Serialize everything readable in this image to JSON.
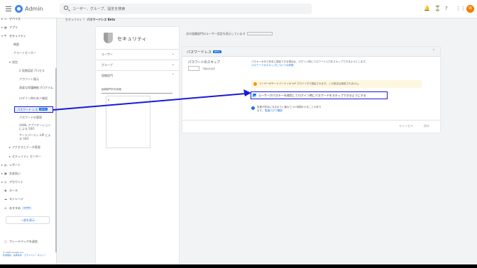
{
  "app": {
    "title": "Admin",
    "avatar_initial": "W"
  },
  "search": {
    "placeholder": "ユーザー、グループ、設定を検索"
  },
  "topbar": {
    "icons": [
      "notifications-icon",
      "hourglass-icon",
      "help-icon",
      "apps-icon"
    ]
  },
  "sidebar": {
    "items": [
      {
        "label": "デバイス"
      },
      {
        "label": "アプリ"
      },
      {
        "label": "セキュリティ"
      },
      {
        "label": "概要"
      },
      {
        "label": "アラートセンター"
      },
      {
        "label": "設定"
      },
      {
        "label": "2 段階認証プロセス"
      },
      {
        "label": "アカウント復元"
      },
      {
        "label": "高度な保護機能プログラム"
      },
      {
        "label": "ログイン時の本人確認"
      },
      {
        "label": "パスワード レス",
        "badge": "BETA"
      },
      {
        "label": "パスワードの管理"
      },
      {
        "label": "SAML アプリケーションによる SSO"
      },
      {
        "label": "サードパーティ IdP による SSO"
      },
      {
        "label": "アクセスとデータ管理"
      },
      {
        "label": "セキュリティ センター"
      },
      {
        "label": "レポート"
      },
      {
        "label": "お支払い"
      },
      {
        "label": "アカウント"
      },
      {
        "label": "ルール"
      },
      {
        "label": "ストレージ"
      },
      {
        "label": "おすすめ",
        "badge": "ALPHA"
      }
    ],
    "more_button": "一部を表示",
    "feedback": "フィードバックを送信",
    "footer_line1": "© 2025 Google Inc.",
    "footer_line2": "利用規約 · 請求条件 · プライバシー ポリシー"
  },
  "breadcrumb": {
    "parent": "セキュリティ",
    "sep": "〉",
    "current": "パスワードレス Beta"
  },
  "left_panel": {
    "title": "セキュリティ",
    "rows": [
      "ユーザー",
      "グループ",
      "組織部門"
    ],
    "search_label": "組織部門内を検索"
  },
  "top_info": "次の組織部門のユーザー設定を表示しています",
  "card": {
    "header": "パスワードレス",
    "header_badge": "BETA",
    "setting_label": "パスワードのスキップ",
    "setting_sub": "下線付き表示",
    "description": "パスキーのみで安全に認証できる場合は、ログイン時にパスワード入力をスキップできるようにします。",
    "description_link": "パスワードのスキップについての詳細",
    "warning": "ユーザーがサードパーティの IdP プロバイダで認証されます。この設定は適用されません。",
    "checkbox_label": "ユーザーがパスキーを使用してログイン時にパスワードをスキップできるようにする",
    "checkbox_checked": true,
    "note": "変更が有効になるまでに最大で 24 時間かかることがあります。",
    "note_link": "監査ログで確認",
    "cancel_label": "キャンセル",
    "save_label": "保存"
  },
  "colors": {
    "highlight": "#1a1ad8",
    "accent": "#1a73e8",
    "warning": "#fef7e0"
  }
}
